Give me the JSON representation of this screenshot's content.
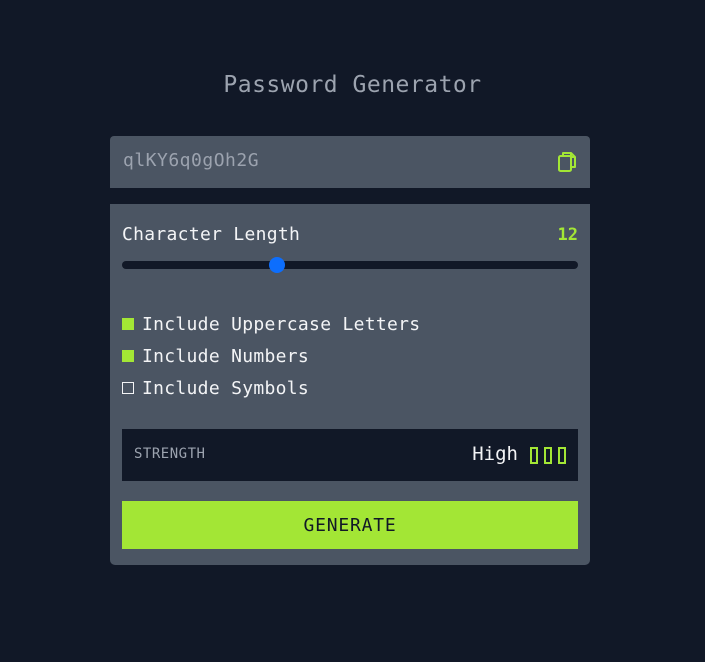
{
  "app": {
    "title": "Password Generator"
  },
  "output": {
    "password": "qlKY6q0gOh2G",
    "copy_icon": "copy-icon"
  },
  "length": {
    "label": "Character Length",
    "value": "12",
    "slider_fraction": 0.34
  },
  "options": [
    {
      "label": "Include Uppercase Letters",
      "checked": true
    },
    {
      "label": "Include Numbers",
      "checked": true
    },
    {
      "label": "Include Symbols",
      "checked": false
    }
  ],
  "strength": {
    "label": "STRENGTH",
    "level": "High",
    "bars": 3
  },
  "actions": {
    "generate_label": "GENERATE"
  },
  "colors": {
    "background": "#111827",
    "panel": "#4b5563",
    "accent": "#a3e635",
    "slider_thumb": "#0d6efd"
  }
}
